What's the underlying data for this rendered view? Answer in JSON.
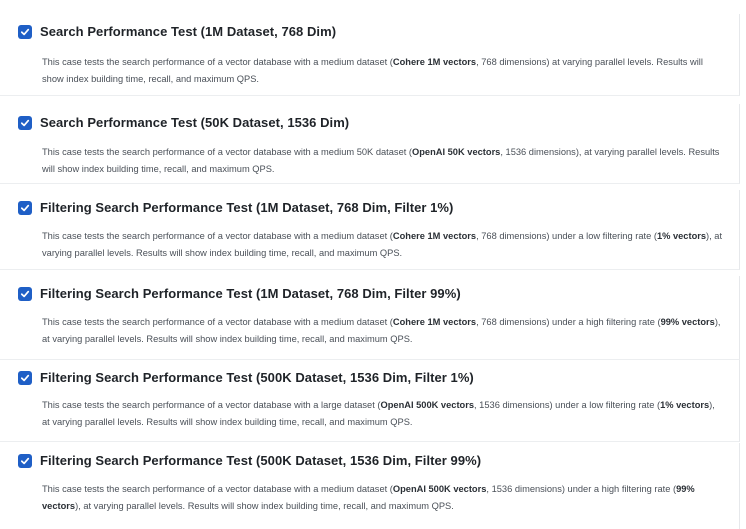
{
  "cases": [
    {
      "title": "Search Performance Test (1M Dataset, 768 Dim)",
      "checked": true,
      "desc_parts": [
        {
          "text": "This case tests the search performance of a vector database with a medium dataset (",
          "bold": false
        },
        {
          "text": "Cohere 1M vectors",
          "bold": true
        },
        {
          "text": ", 768 dimensions) at varying parallel levels. Results will show index building time, recall, and maximum QPS.",
          "bold": false
        }
      ]
    },
    {
      "title": "Search Performance Test (50K Dataset, 1536 Dim)",
      "checked": true,
      "desc_parts": [
        {
          "text": "This case tests the search performance of a vector database with a medium 50K dataset (",
          "bold": false
        },
        {
          "text": "OpenAI 50K vectors",
          "bold": true
        },
        {
          "text": ", 1536 dimensions), at varying parallel levels. Results will show index building time, recall, and maximum QPS.",
          "bold": false
        }
      ]
    },
    {
      "title": "Filtering Search Performance Test (1M Dataset, 768 Dim, Filter 1%)",
      "checked": true,
      "desc_parts": [
        {
          "text": "This case tests the search performance of a vector database with a medium dataset (",
          "bold": false
        },
        {
          "text": "Cohere 1M vectors",
          "bold": true
        },
        {
          "text": ", 768 dimensions) under a low filtering rate (",
          "bold": false
        },
        {
          "text": "1% vectors",
          "bold": true
        },
        {
          "text": "), at varying parallel levels. Results will show index building time, recall, and maximum QPS.",
          "bold": false
        }
      ]
    },
    {
      "title": "Filtering Search Performance Test (1M Dataset, 768 Dim, Filter 99%)",
      "checked": true,
      "desc_parts": [
        {
          "text": "This case tests the search performance of a vector database with a medium dataset (",
          "bold": false
        },
        {
          "text": "Cohere 1M vectors",
          "bold": true
        },
        {
          "text": ", 768 dimensions) under a high filtering rate (",
          "bold": false
        },
        {
          "text": "99% vectors",
          "bold": true
        },
        {
          "text": "), at varying parallel levels. Results will show index building time, recall, and maximum QPS.",
          "bold": false
        }
      ]
    },
    {
      "title": "Filtering Search Performance Test (500K Dataset, 1536 Dim, Filter 1%)",
      "checked": true,
      "desc_parts": [
        {
          "text": "This case tests the search performance of a vector database with a large dataset (",
          "bold": false
        },
        {
          "text": "OpenAI 500K vectors",
          "bold": true
        },
        {
          "text": ", 1536 dimensions) under a low filtering rate (",
          "bold": false
        },
        {
          "text": "1% vectors",
          "bold": true
        },
        {
          "text": "), at varying parallel levels. Results will show index building time, recall, and maximum QPS.",
          "bold": false
        }
      ]
    },
    {
      "title": "Filtering Search Performance Test (500K Dataset, 1536 Dim, Filter 99%)",
      "checked": true,
      "desc_parts": [
        {
          "text": "This case tests the search performance of a vector database with a medium dataset (",
          "bold": false
        },
        {
          "text": "OpenAI 500K vectors",
          "bold": true
        },
        {
          "text": ", 1536 dimensions) under a high filtering rate (",
          "bold": false
        },
        {
          "text": "99% vectors",
          "bold": true
        },
        {
          "text": "), at varying parallel levels. Results will show index building time, recall, and maximum QPS.",
          "bold": false
        }
      ]
    }
  ],
  "colors": {
    "checkbox": "#1f5fc6",
    "title": "#1f2328",
    "description": "#4a5058",
    "divider": "#e6e8eb"
  },
  "icons": {
    "checkbox": "check-icon"
  }
}
